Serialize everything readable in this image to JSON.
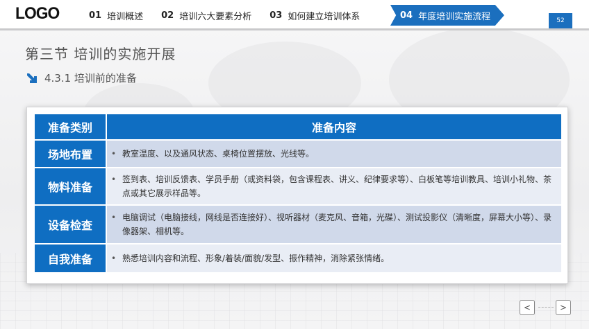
{
  "header": {
    "logo": "LOGO",
    "nav": [
      {
        "num": "01",
        "label": "培训概述"
      },
      {
        "num": "02",
        "label": "培训六大要素分析"
      },
      {
        "num": "03",
        "label": "如何建立培训体系"
      },
      {
        "num": "04",
        "label": "年度培训实施流程"
      }
    ],
    "active_index": 3,
    "page_number": "52"
  },
  "section_title": "第三节  培训的实施开展",
  "sub_title": "4.3.1 培训前的准备",
  "table": {
    "headers": [
      "准备类别",
      "准备内容"
    ],
    "rows": [
      {
        "category": "场地布置",
        "content": "教室温度、以及通风状态、桌椅位置摆放、光线等。"
      },
      {
        "category": "物料准备",
        "content": "签到表、培训反馈表、学员手册（或资料袋，包含课程表、讲义、纪律要求等）、白板笔等培训教具、培训小礼物、茶点或其它展示样品等。"
      },
      {
        "category": "设备检查",
        "content": "电脑调试（电脑接线，网线是否连接好）、视听器材（麦克风、音箱，光碟）、测试投影仪（清晰度，屏幕大小等）、录像器架、相机等。"
      },
      {
        "category": "自我准备",
        "content": "熟悉培训内容和流程、形象/着装/面貌/发型、振作精神，消除紧张情绪。"
      }
    ]
  },
  "pager": {
    "prev_icon": "chevron-left-icon",
    "next_icon": "chevron-right-icon",
    "prev_glyph": "<",
    "next_glyph": ">"
  },
  "colors": {
    "accent": "#1b6fbe",
    "table_header": "#0f6ec2",
    "row_dark": "#d0d9ea",
    "row_light": "#e9edf5"
  }
}
